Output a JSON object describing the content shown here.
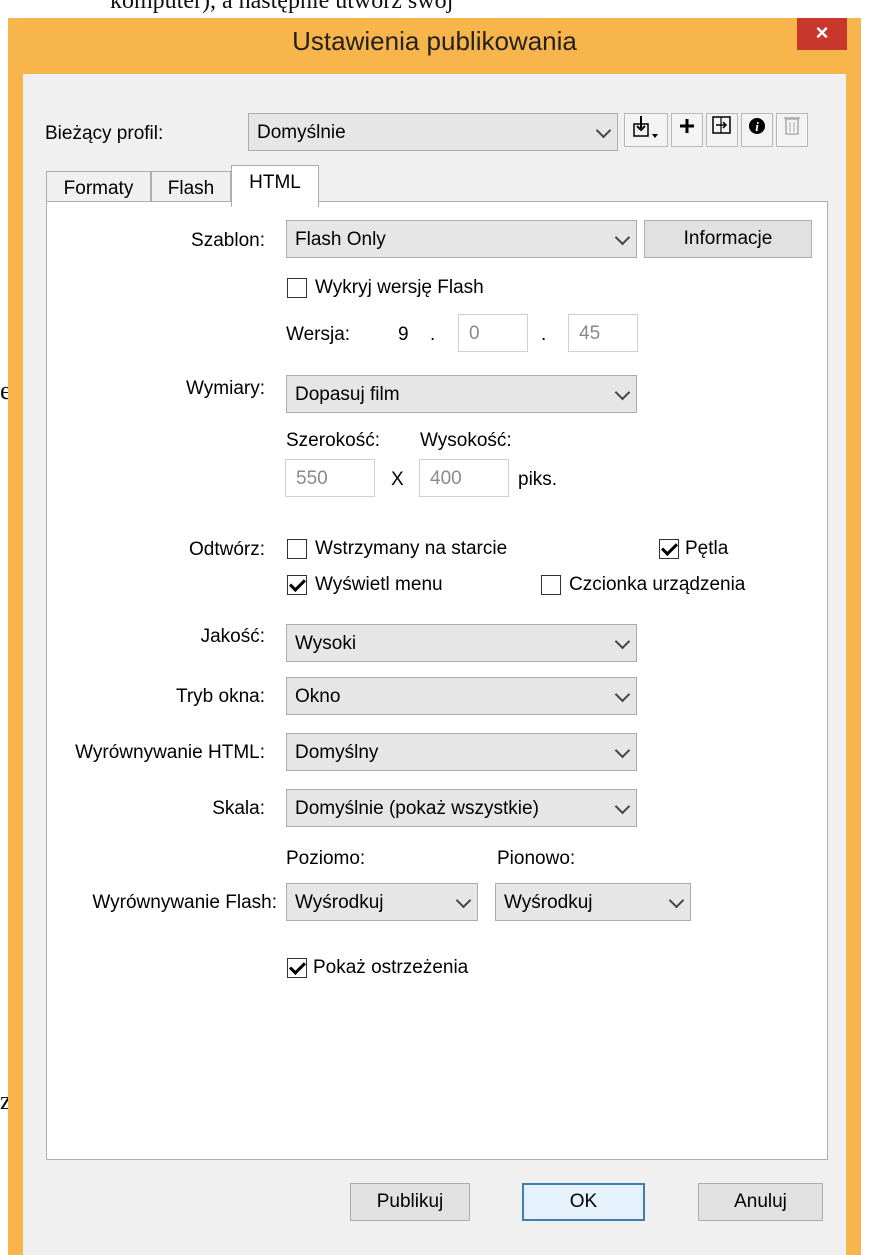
{
  "background": {
    "top_text": "komputer), a następnie utwórz swój",
    "frag1": "e",
    "frag2": "z"
  },
  "dialog": {
    "title": "Ustawienia publikowania",
    "close_label": "×",
    "profile": {
      "label": "Bieżący profil:",
      "value": "Domyślnie"
    },
    "tabs": [
      {
        "label": "Formaty"
      },
      {
        "label": "Flash"
      },
      {
        "label": "HTML"
      }
    ],
    "template": {
      "label": "Szablon:",
      "value": "Flash Only",
      "info_button": "Informacje"
    },
    "detect_flash": {
      "label": "Wykryj wersję Flash",
      "checked": false
    },
    "version": {
      "label": "Wersja:",
      "major": "9",
      "dot1": ".",
      "minor": "0",
      "dot2": ".",
      "revision": "45"
    },
    "dimensions": {
      "label": "Wymiary:",
      "value": "Dopasuj film",
      "width_label": "Szerokość:",
      "height_label": "Wysokość:",
      "width": "550",
      "x": "X",
      "height": "400",
      "unit": "piks."
    },
    "playback": {
      "label": "Odtwórz:",
      "paused_at_start": {
        "label": "Wstrzymany na starcie",
        "checked": false
      },
      "loop": {
        "label": "Pętla",
        "checked": true
      },
      "display_menu": {
        "label": "Wyświetl menu",
        "checked": true
      },
      "device_font": {
        "label": "Czcionka urządzenia",
        "checked": false
      }
    },
    "quality": {
      "label": "Jakość:",
      "value": "Wysoki"
    },
    "window_mode": {
      "label": "Tryb okna:",
      "value": "Okno"
    },
    "html_align": {
      "label": "Wyrównywanie HTML:",
      "value": "Domyślny"
    },
    "scale": {
      "label": "Skala:",
      "value": "Domyślnie (pokaż wszystkie)"
    },
    "flash_align": {
      "label": "Wyrównywanie Flash:",
      "horizontal_label": "Poziomo:",
      "horizontal_value": "Wyśrodkuj",
      "vertical_label": "Pionowo:",
      "vertical_value": "Wyśrodkuj"
    },
    "show_warnings": {
      "label": "Pokaż ostrzeżenia",
      "checked": true
    },
    "buttons": {
      "publish": "Publikuj",
      "ok": "OK",
      "cancel": "Anuluj"
    },
    "colors": {
      "frame": "#f7b54c",
      "close": "#c7372c",
      "client": "#f0f0f0"
    }
  }
}
